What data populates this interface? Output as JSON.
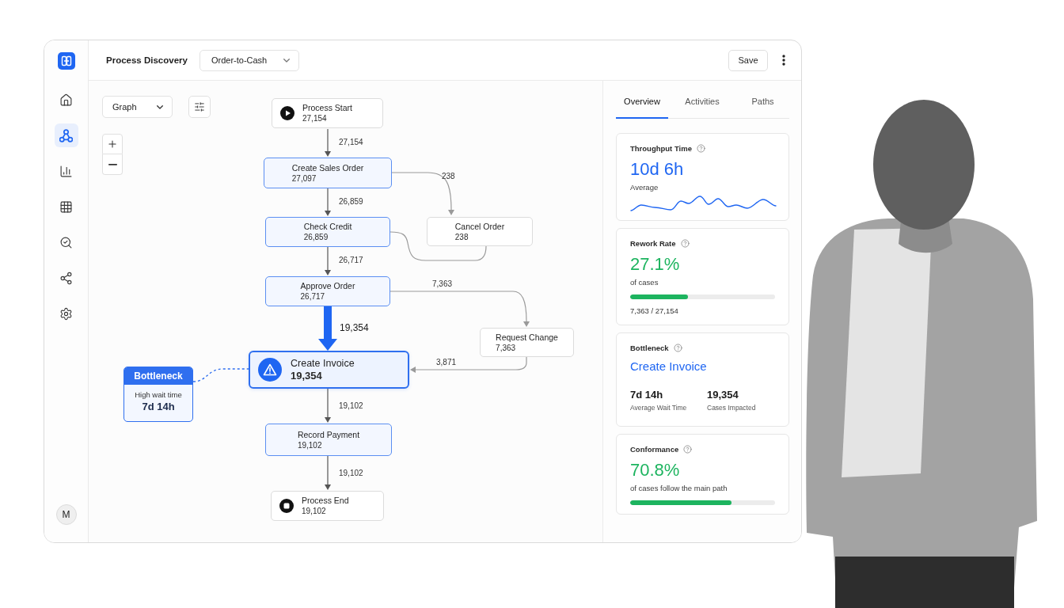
{
  "sidebar": {
    "items": [
      {
        "selected": false
      },
      {
        "selected": true
      },
      {
        "selected": false
      },
      {
        "selected": false
      },
      {
        "selected": false
      },
      {
        "selected": false
      },
      {
        "selected": false
      }
    ],
    "avatar": "M"
  },
  "topbar": {
    "title": "Process Discovery",
    "process_select": "Order-to-Cash",
    "save_button": "Save"
  },
  "canvas": {
    "view_select": "Graph",
    "nodes": [
      {
        "kind": "start",
        "label": "Process Start",
        "count": "27,154"
      },
      {
        "kind": "activity",
        "label": "Create Sales Order",
        "count": "27,097"
      },
      {
        "kind": "activity",
        "label": "Check Credit",
        "count": "26,859"
      },
      {
        "kind": "branch",
        "label": "Cancel Order",
        "count": "238"
      },
      {
        "kind": "activity",
        "label": "Approve Order",
        "count": "26,717"
      },
      {
        "kind": "branch",
        "label": "Request Change",
        "count": "7,363"
      },
      {
        "kind": "focus",
        "label": "Create Invoice",
        "count": "19,354"
      },
      {
        "kind": "activity",
        "label": "Record Payment",
        "count": "19,102"
      },
      {
        "kind": "end",
        "label": "Process End",
        "count": "19,102"
      }
    ],
    "edges": [
      {
        "kind": "main",
        "label": "27,154"
      },
      {
        "kind": "side",
        "label": "238"
      },
      {
        "kind": "main",
        "label": "26,859"
      },
      {
        "kind": "side"
      },
      {
        "kind": "main",
        "label": "26,717"
      },
      {
        "kind": "side",
        "label": "7,363"
      },
      {
        "kind": "heavy",
        "label": "19,354"
      },
      {
        "kind": "side",
        "label": "3,871"
      },
      {
        "kind": "main",
        "label": "19,102"
      },
      {
        "kind": "main",
        "label": "19,102"
      }
    ],
    "callout": {
      "title": "Bottleneck",
      "caption": "High wait time",
      "value": "7d 14h"
    }
  },
  "panel": {
    "tabs": [
      {
        "label": "Overview",
        "selected": true
      },
      {
        "label": "Activities",
        "selected": false
      },
      {
        "label": "Paths",
        "selected": false
      }
    ],
    "cards": [
      {
        "kind": "trend",
        "title": "Throughput Time",
        "value": "10d 6h",
        "caption": "Average"
      },
      {
        "kind": "ratio",
        "title": "Rework Rate",
        "value": "27.1%",
        "caption": "of cases",
        "level": 0.4,
        "detail": "7,363 / 27,154"
      },
      {
        "kind": "bottleneck",
        "title": "Bottleneck",
        "activity": "Create Invoice",
        "stats": [
          {
            "value": "7d 14h",
            "label": "Average Wait Time"
          },
          {
            "value": "19,354",
            "label": "Cases Impacted"
          }
        ]
      },
      {
        "kind": "ratio",
        "title": "Conformance",
        "value": "70.8%",
        "caption": "of cases follow the main path",
        "level": 0.7
      }
    ]
  }
}
